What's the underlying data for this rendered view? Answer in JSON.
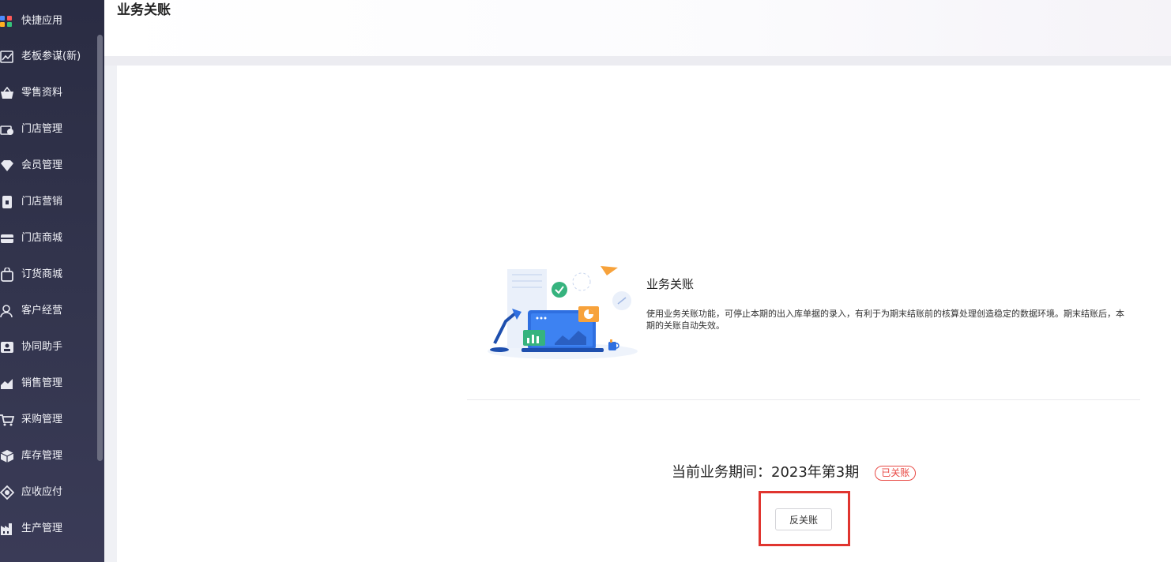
{
  "sidebar": {
    "items": [
      {
        "label": "快捷应用",
        "icon": "apps-grid-icon"
      },
      {
        "label": "老板参谋(新)",
        "icon": "chart-analytics-icon"
      },
      {
        "label": "零售资料",
        "icon": "basket-icon"
      },
      {
        "label": "门店管理",
        "icon": "store-camera-icon"
      },
      {
        "label": "会员管理",
        "icon": "member-heart-icon"
      },
      {
        "label": "门店营销",
        "icon": "tag-icon"
      },
      {
        "label": "门店商城",
        "icon": "mall-icon"
      },
      {
        "label": "订货商城",
        "icon": "shopping-bag-icon"
      },
      {
        "label": "客户经营",
        "icon": "customer-icon"
      },
      {
        "label": "协同助手",
        "icon": "contact-card-icon"
      },
      {
        "label": "销售管理",
        "icon": "sales-trend-icon"
      },
      {
        "label": "采购管理",
        "icon": "cart-icon"
      },
      {
        "label": "库存管理",
        "icon": "box-icon"
      },
      {
        "label": "应收应付",
        "icon": "finance-icon"
      },
      {
        "label": "生产管理",
        "icon": "factory-icon"
      }
    ]
  },
  "header": {
    "title": "业务关账"
  },
  "feature": {
    "title": "业务关账",
    "description": "使用业务关账功能，可停止本期的出入库单据的录入，有利于为期末结账前的核算处理创造稳定的数据环境。期末结账后，本期的关账自动失效。"
  },
  "period": {
    "label": "当前业务期间：",
    "value": "2023年第3期",
    "status": "已关账"
  },
  "actions": {
    "reverse_label": "反关账"
  },
  "colors": {
    "sidebar_bg": "#2c2e46",
    "status_red": "#e84a45",
    "highlight_red": "#e0352f",
    "illustration_blue": "#2f6fe0"
  }
}
